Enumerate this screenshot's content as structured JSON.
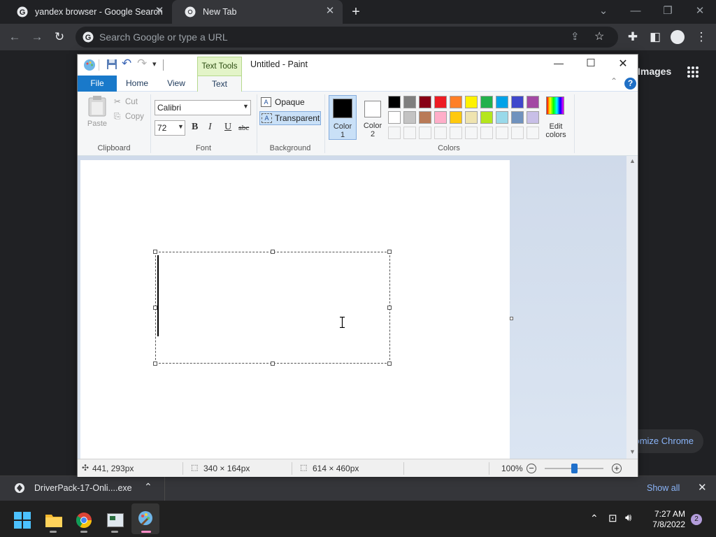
{
  "chrome": {
    "tabs": [
      {
        "title": "yandex browser - Google Search"
      },
      {
        "title": "New Tab"
      }
    ],
    "omnibox_placeholder": "Search Google or type a URL",
    "ntp": {
      "images_link": "Images",
      "customize_button": "Customize Chrome"
    },
    "download": {
      "filename": "DriverPack-17-Onli....exe",
      "show_all": "Show all"
    }
  },
  "paint": {
    "title": "Untitled - Paint",
    "contextual_tab": "Text Tools",
    "tabs": [
      "File",
      "Home",
      "View",
      "Text"
    ],
    "clipboard": {
      "paste": "Paste",
      "cut": "Cut",
      "copy": "Copy",
      "group": "Clipboard"
    },
    "font": {
      "family": "Calibri",
      "size": "72",
      "bold": "B",
      "italic": "I",
      "underline": "U",
      "strikethrough": "abc",
      "group": "Font"
    },
    "background": {
      "opaque": "Opaque",
      "transparent": "Transparent",
      "selected": "Transparent",
      "group": "Background"
    },
    "colors": {
      "color1_label": "Color\n1",
      "color2_label": "Color\n2",
      "color1": "#000000",
      "color2": "#ffffff",
      "edit_colors": "Edit colors",
      "group": "Colors",
      "palette_row1": [
        "#000000",
        "#7f7f7f",
        "#880015",
        "#ed1c24",
        "#ff7f27",
        "#fff200",
        "#22b14c",
        "#00a2e8",
        "#3f48cc",
        "#a349a4"
      ],
      "palette_row2": [
        "#ffffff",
        "#c3c3c3",
        "#b97a57",
        "#ffaec9",
        "#ffc90e",
        "#efe4b0",
        "#b5e61d",
        "#99d9ea",
        "#7092be",
        "#c8bfe7"
      ]
    },
    "status": {
      "cursor": "441, 293px",
      "selection": "340 × 164px",
      "canvas": "614 × 460px",
      "zoom": "100%",
      "zoom_level": 0.5
    }
  },
  "taskbar": {
    "time": "7:27 AM",
    "date": "7/8/2022",
    "notifications": "2"
  }
}
